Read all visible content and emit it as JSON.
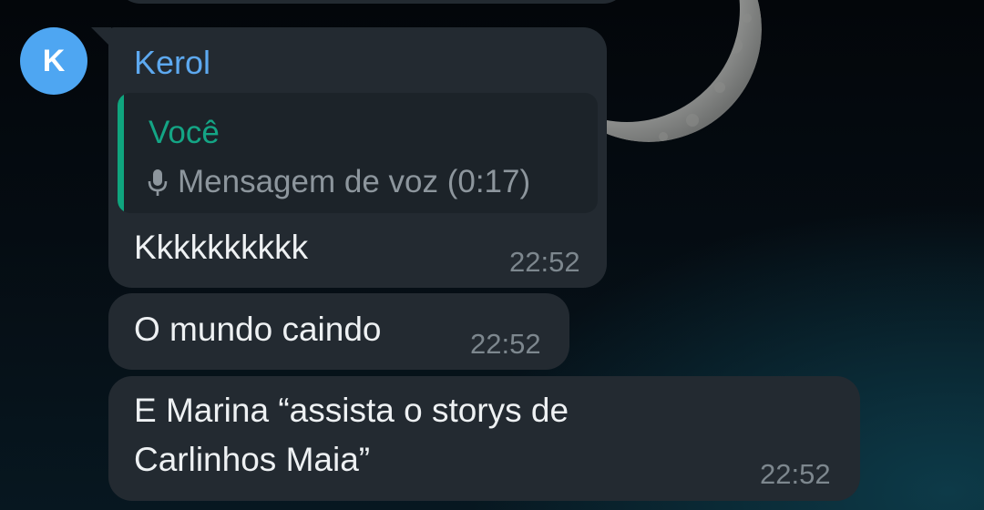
{
  "colors": {
    "bubble": "#232a31",
    "quote_bg": "#1c2329",
    "sender_name": "#5da9f0",
    "quote_accent": "#14a585",
    "avatar_bg": "#4ea6f2",
    "text": "#eef1f3",
    "meta": "#7d878e"
  },
  "chat": {
    "avatar_letter": "K",
    "messages": [
      {
        "sender": "Kerol",
        "reply": {
          "author": "Você",
          "icon": "mic-icon",
          "preview": "Mensagem de voz (0:17)"
        },
        "text": "Kkkkkkkkkk",
        "time": "22:52"
      },
      {
        "text": "O mundo caindo",
        "time": "22:52"
      },
      {
        "lines": [
          "E Marina “assista o storys de",
          "Carlinhos Maia”"
        ],
        "time": "22:52"
      }
    ]
  }
}
